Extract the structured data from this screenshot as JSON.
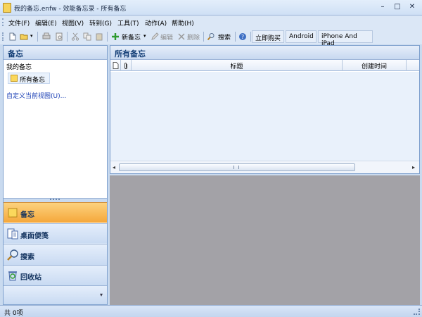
{
  "window": {
    "title": "我的备忘.enfw - 效能备忘录 - 所有备忘",
    "minimize": "–",
    "maximize": "□",
    "close": "✕"
  },
  "menu": [
    "文件(F)",
    "编辑(E)",
    "视图(V)",
    "转到(G)",
    "工具(T)",
    "动作(A)",
    "帮助(H)"
  ],
  "toolbar": {
    "new_memo": "新备忘",
    "edit": "编辑",
    "delete": "删除",
    "search": "搜索",
    "buy_now": "立即购买",
    "android": "Android",
    "iphone_ipad": "iPhone And iPad"
  },
  "left_panel": {
    "header": "备忘",
    "group_label": "我的备忘",
    "tree_item": "所有备忘",
    "custom_view_link": "自定义当前视图(U)..."
  },
  "nav_buttons": [
    {
      "label": "备忘",
      "icon": "memo-icon",
      "active": true
    },
    {
      "label": "桌面便笺",
      "icon": "sticky-note-icon",
      "active": false
    },
    {
      "label": "搜索",
      "icon": "search-icon",
      "active": false
    },
    {
      "label": "回收站",
      "icon": "recycle-bin-icon",
      "active": false
    }
  ],
  "right_panel": {
    "header": "所有备忘",
    "columns": [
      "",
      "",
      "标题",
      "创建时间"
    ]
  },
  "status": {
    "count_text": "共 0项"
  },
  "colors": {
    "accent": "#f5a73a",
    "panel_header": "#143f77",
    "preview_bg": "#a3a2a7"
  }
}
